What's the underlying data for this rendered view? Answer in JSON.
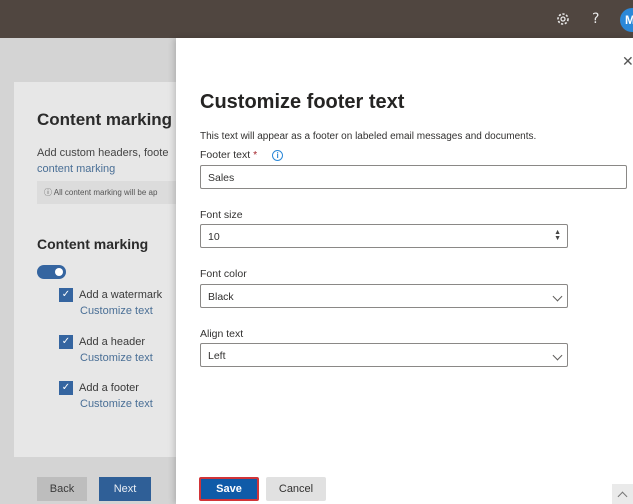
{
  "topbar": {
    "icons": [
      "gear-icon",
      "help-icon"
    ],
    "help_glyph": "?",
    "avatar_initial": "M"
  },
  "background": {
    "title": "Content marking",
    "description": "Add custom headers, foote",
    "link": "content marking",
    "info_text": "All content marking will be ap",
    "section_title": "Content marking",
    "options": [
      {
        "label": "Add a watermark",
        "link": "Customize text"
      },
      {
        "label": "Add a header",
        "link": "Customize text"
      },
      {
        "label": "Add a footer",
        "link": "Customize text"
      }
    ],
    "back_label": "Back",
    "next_label": "Next"
  },
  "panel": {
    "title": "Customize footer text",
    "description": "This text will appear as a footer on labeled email messages and documents.",
    "footer_text_label": "Footer text",
    "required_mark": "*",
    "footer_text_value": "Sales",
    "font_size_label": "Font size",
    "font_size_value": "10",
    "font_color_label": "Font color",
    "font_color_value": "Black",
    "align_label": "Align text",
    "align_value": "Left",
    "save_label": "Save",
    "cancel_label": "Cancel"
  },
  "colors": {
    "accent": "#0f5ba8",
    "highlight_border": "#d13438",
    "topbar": "#504640"
  }
}
